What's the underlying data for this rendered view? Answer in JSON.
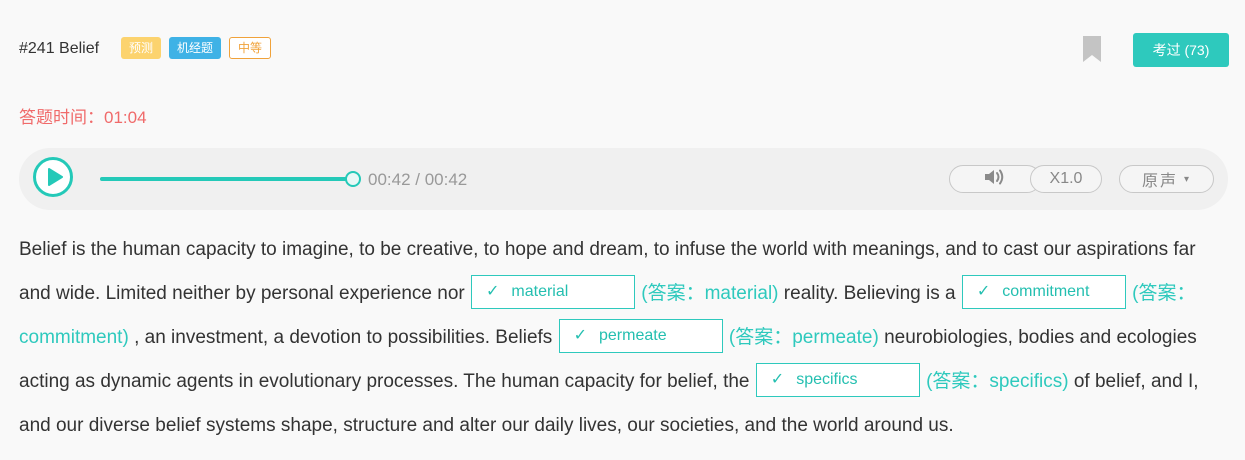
{
  "header": {
    "question_title": "#241 Belief",
    "tags": [
      {
        "label": "预测",
        "color": "#fcd36e"
      },
      {
        "label": "机经题",
        "color": "#3fb2e6"
      },
      {
        "label": "中等",
        "color": "#f0a23a"
      }
    ],
    "done_button": "考过 (73)",
    "bookmark_icon": "bookmark-icon"
  },
  "timer": "答题时间：01:04",
  "player": {
    "play_icon": "play-icon",
    "progress": 1.0,
    "time": "00:42 / 00:42",
    "volume_icon": "volume-icon",
    "speed": "X1.0",
    "voice": "原声",
    "voice_caret": "▾"
  },
  "passage": {
    "check_mark": "✓",
    "seg1": "Belief is the human capacity to imagine, to be creative, to hope and dream, to infuse the world with meanings, and to cast our aspirations far and wide. Limited neither by personal experience nor",
    "blank1": "material",
    "answer1": "(答案：material)",
    "seg2": "reality. Believing is a",
    "blank2": "commitment",
    "answer2": "(答案：commitment)",
    "seg3": ", an investment, a devotion to possibilities. Beliefs",
    "blank3": "permeate",
    "answer3": "(答案：permeate)",
    "seg4": "neurobiologies, bodies and ecologies acting as dynamic agents in evolutionary processes. The human capacity for belief, the",
    "blank4": "specifics",
    "answer4": "(答案：specifics)",
    "seg5": "of belief, and I, and our diverse belief systems shape, structure and alter our daily lives, our societies, and the world around us."
  },
  "colors": {
    "accent": "#2ec9bd",
    "timer": "#f06a6a"
  }
}
